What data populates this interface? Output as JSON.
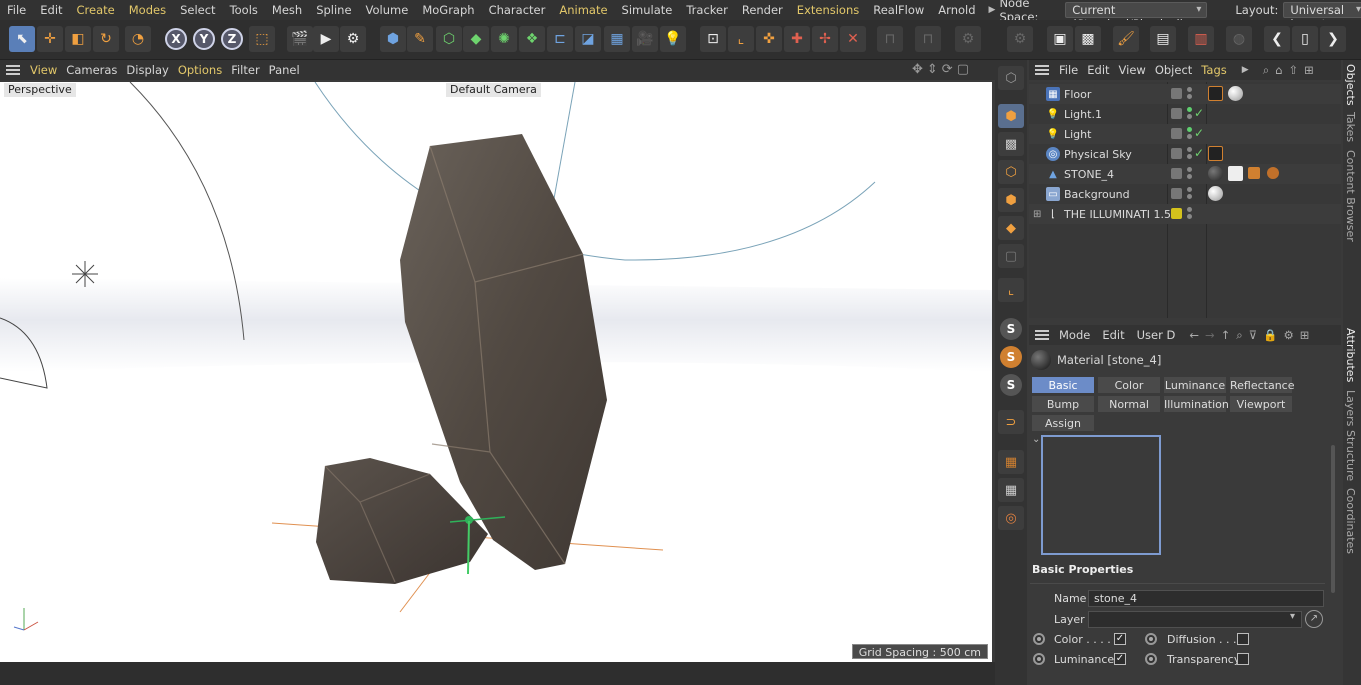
{
  "menubar": {
    "items": [
      {
        "label": "File",
        "hl": false
      },
      {
        "label": "Edit",
        "hl": false
      },
      {
        "label": "Create",
        "hl": true
      },
      {
        "label": "Modes",
        "hl": true
      },
      {
        "label": "Select",
        "hl": false
      },
      {
        "label": "Tools",
        "hl": false
      },
      {
        "label": "Mesh",
        "hl": false
      },
      {
        "label": "Spline",
        "hl": false
      },
      {
        "label": "Volume",
        "hl": false
      },
      {
        "label": "MoGraph",
        "hl": false
      },
      {
        "label": "Character",
        "hl": false
      },
      {
        "label": "Animate",
        "hl": true
      },
      {
        "label": "Simulate",
        "hl": false
      },
      {
        "label": "Tracker",
        "hl": false
      },
      {
        "label": "Render",
        "hl": false
      },
      {
        "label": "Extensions",
        "hl": true
      },
      {
        "label": "RealFlow",
        "hl": false
      },
      {
        "label": "Arnold",
        "hl": false
      }
    ],
    "node_space_label": "Node Space:",
    "node_space_value": "Current (Standard/Physical)",
    "layout_label": "Layout:",
    "layout_value": "Universal layout (User)"
  },
  "viewport_menu": {
    "items": [
      {
        "label": "View",
        "hl": true
      },
      {
        "label": "Cameras",
        "hl": false
      },
      {
        "label": "Display",
        "hl": false
      },
      {
        "label": "Options",
        "hl": true
      },
      {
        "label": "Filter",
        "hl": false
      },
      {
        "label": "Panel",
        "hl": false
      }
    ]
  },
  "viewport": {
    "projection": "Perspective",
    "camera": "Default Camera",
    "grid_spacing": "Grid Spacing : 500 cm"
  },
  "object_manager": {
    "menu": [
      {
        "label": "File",
        "hl": false
      },
      {
        "label": "Edit",
        "hl": false
      },
      {
        "label": "View",
        "hl": false
      },
      {
        "label": "Object",
        "hl": false
      },
      {
        "label": "Tags",
        "hl": true
      }
    ],
    "objects": [
      {
        "name": "Floor"
      },
      {
        "name": "Light.1"
      },
      {
        "name": "Light"
      },
      {
        "name": "Physical Sky"
      },
      {
        "name": "STONE_4"
      },
      {
        "name": "Background"
      },
      {
        "name": "THE ILLUMINATI 1.5"
      }
    ]
  },
  "attribute_manager": {
    "menu": [
      "Mode",
      "Edit",
      "User D"
    ],
    "title": "Material [stone_4]",
    "tabs": [
      "Basic",
      "Color",
      "Luminance",
      "Reflectance",
      "Bump",
      "Normal",
      "Illumination",
      "Viewport",
      "Assign"
    ],
    "active_tab": "Basic",
    "section_title": "Basic Properties",
    "name_label": "Name",
    "name_value": "stone_4",
    "layer_label": "Layer",
    "layer_value": "",
    "channels": [
      {
        "label": "Color . . . .",
        "checked": true
      },
      {
        "label": "Diffusion . . . .",
        "checked": false
      },
      {
        "label": "Luminance",
        "checked": true
      },
      {
        "label": "Transparency",
        "checked": false
      }
    ]
  },
  "side_tabs": [
    "Objects",
    "Takes",
    "Content Browser",
    "Attributes",
    "Layers",
    "Structure",
    "Coordinates"
  ]
}
